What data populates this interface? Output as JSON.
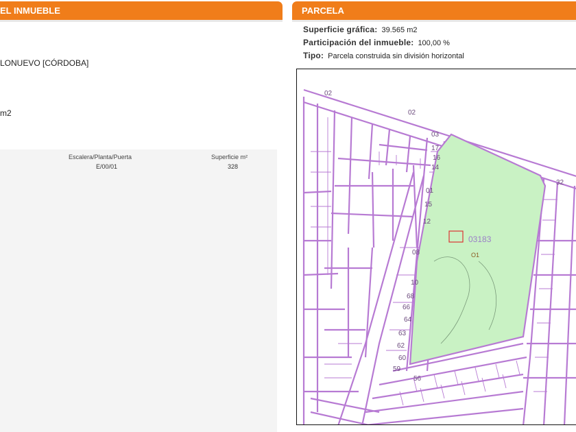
{
  "left_header": {
    "title": "EL INMUEBLE"
  },
  "right_header": {
    "title": "PARCELA"
  },
  "left_fields": {
    "location": "LONUEVO [CÓRDOBA]",
    "surface": "m2"
  },
  "table": {
    "col_location": "Escalera/Planta/Puerta",
    "col_surface": "Superficie m²",
    "row_location": "E/00/01",
    "row_surface": "328"
  },
  "parcela": {
    "superficie_label": "Superficie gráfica:",
    "superficie_value": "39.565 m2",
    "participacion_label": "Participación del inmueble:",
    "participacion_value": "100,00 %",
    "tipo_label": "Tipo:",
    "tipo_value": "Parcela construida sin división horizontal"
  },
  "map": {
    "parcel_number": "03183",
    "street_numbers": [
      "02",
      "02",
      "32",
      "03",
      "01",
      "15",
      "12",
      "08",
      "10",
      "68",
      "66",
      "64",
      "63",
      "62",
      "60",
      "59",
      "56",
      "17",
      "16",
      "14"
    ],
    "green_label": "O1",
    "colors": {
      "parcel_fill": "#c9f2c4",
      "lines": "#b77ad3",
      "border": "#111111"
    }
  }
}
